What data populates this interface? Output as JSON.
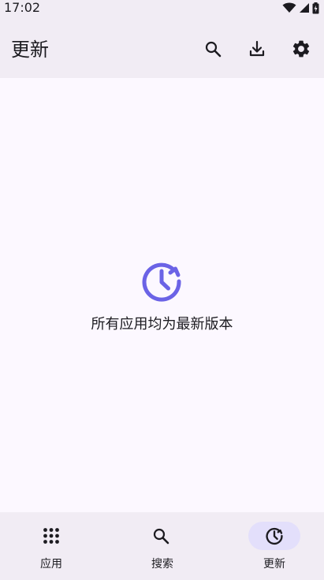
{
  "status_bar": {
    "time": "17:02"
  },
  "app_bar": {
    "title": "更新",
    "actions": [
      {
        "icon": "search-icon"
      },
      {
        "icon": "download-icon"
      },
      {
        "icon": "settings-gear-icon"
      }
    ]
  },
  "empty_state": {
    "icon": "update-clock-icon",
    "message": "所有应用均为最新版本"
  },
  "bottom_nav": {
    "items": [
      {
        "label": "应用",
        "icon": "apps-grid-icon",
        "active": false
      },
      {
        "label": "搜索",
        "icon": "search-icon",
        "active": false
      },
      {
        "label": "更新",
        "icon": "update-clock-icon",
        "active": true
      }
    ]
  },
  "colors": {
    "accent": "#6b63e6",
    "surface": "#fcf8ff",
    "bar": "#f1ecf4",
    "active_indicator": "#e3dffb"
  }
}
